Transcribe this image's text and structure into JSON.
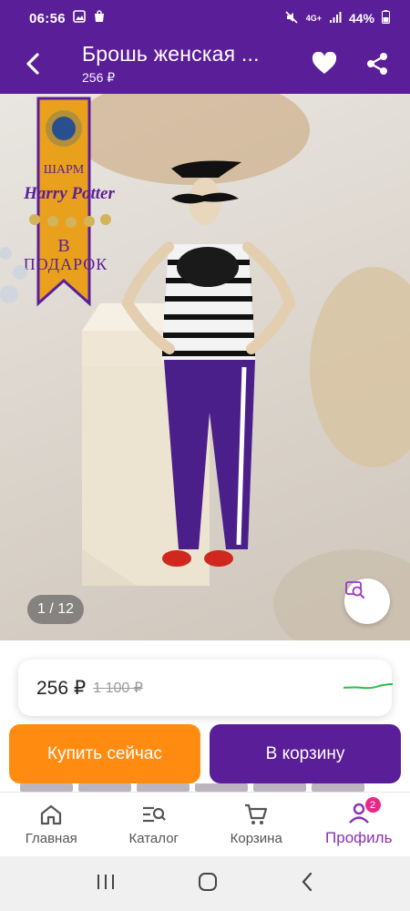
{
  "status_bar": {
    "time": "06:56",
    "network": "4G+",
    "battery": "44%"
  },
  "app_bar": {
    "title": "Брошь женская ...",
    "subtitle": "256 ₽"
  },
  "gallery": {
    "counter": "1 / 12",
    "promo": {
      "line1": "ШАРМ",
      "line2": "Harry Potter",
      "line3": "В",
      "line4": "ПОДАРОК"
    }
  },
  "price": {
    "current": "256 ₽",
    "old": "1 100 ₽",
    "trend_color": "#2bbd4a"
  },
  "actions": {
    "buy_now": "Купить сейчас",
    "add_to_cart": "В корзину"
  },
  "bottom_nav": {
    "items": [
      {
        "label": "Главная",
        "icon": "home-icon"
      },
      {
        "label": "Каталог",
        "icon": "catalog-search-icon"
      },
      {
        "label": "Корзина",
        "icon": "cart-icon"
      },
      {
        "label": "Профиль",
        "icon": "profile-icon",
        "badge": "2",
        "active": true
      }
    ]
  },
  "colors": {
    "brand_purple": "#5b1e99",
    "accent_orange": "#ff8c10",
    "active_tab": "#8b2fb6",
    "badge_pink": "#e8278a"
  }
}
